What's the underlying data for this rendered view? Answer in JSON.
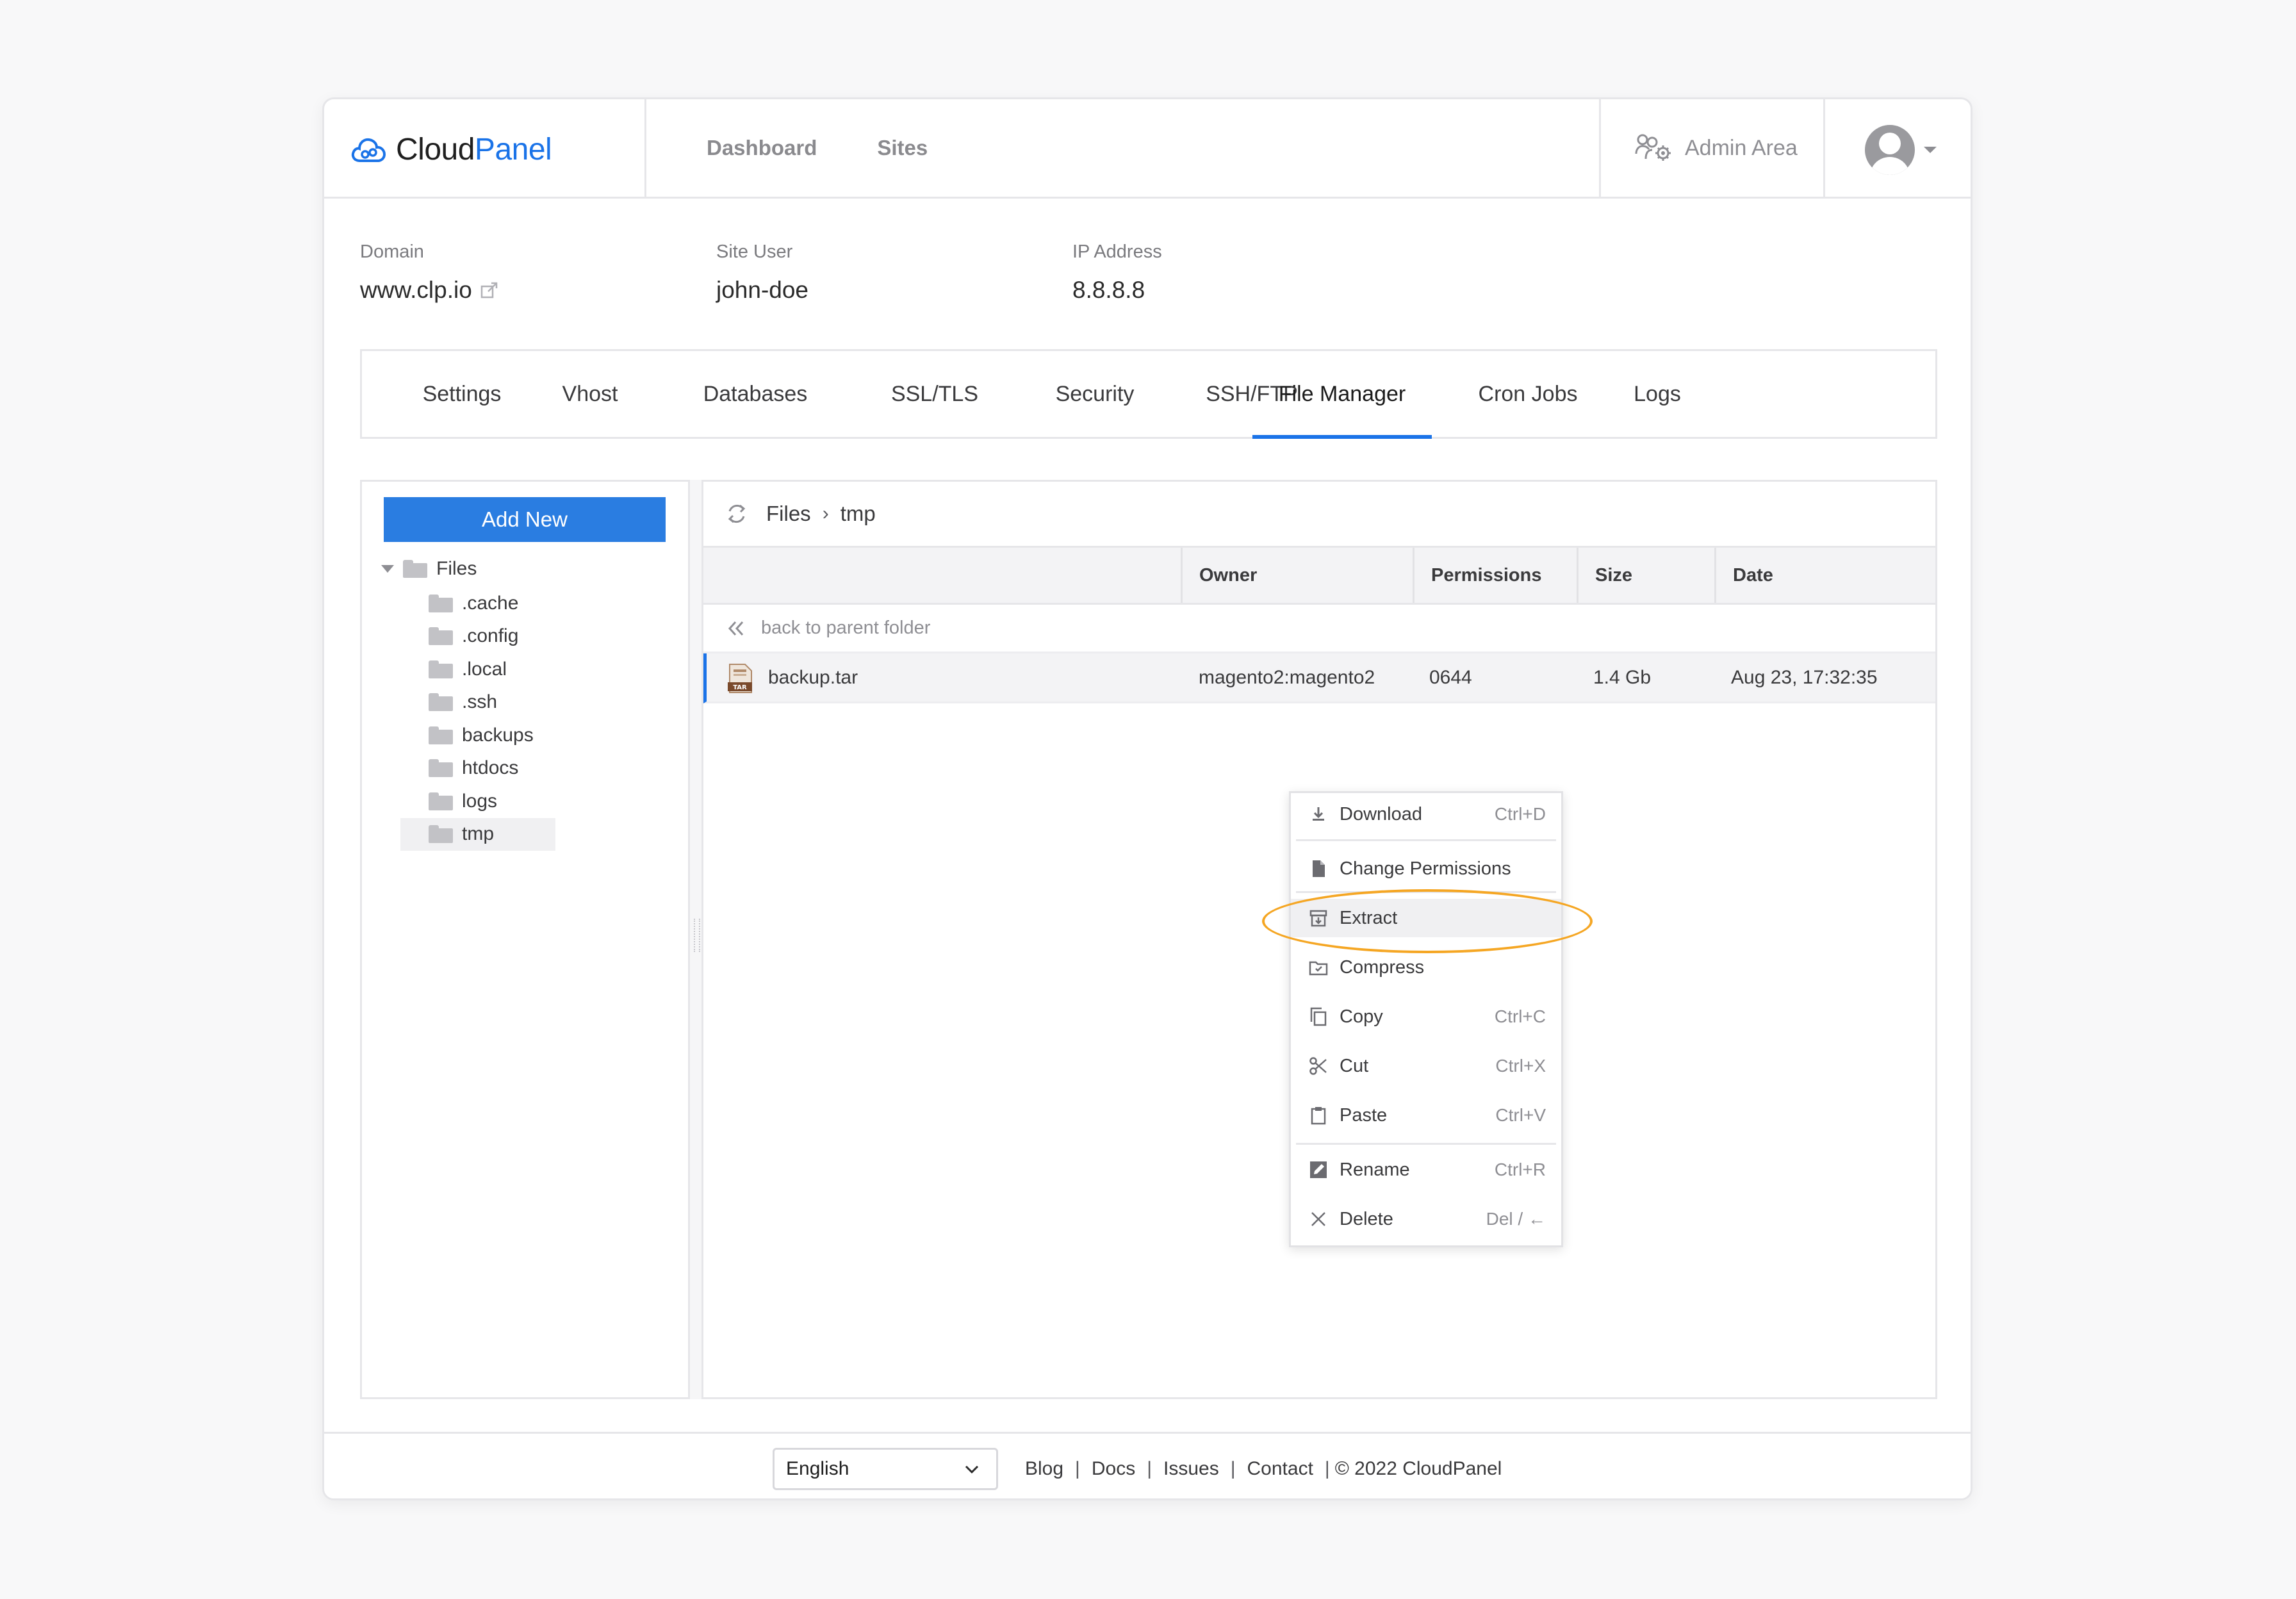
{
  "brand": {
    "name_part1": "Cloud",
    "name_part2": "Panel",
    "accent": "#1a73e8"
  },
  "nav": {
    "items": [
      "Dashboard",
      "Sites"
    ]
  },
  "header": {
    "admin_label": "Admin Area"
  },
  "site": {
    "domain_label": "Domain",
    "domain_value": "www.clp.io",
    "user_label": "Site User",
    "user_value": "john-doe",
    "ip_label": "IP Address",
    "ip_value": "8.8.8.8"
  },
  "tabs": [
    "Settings",
    "Vhost",
    "Databases",
    "SSL/TLS",
    "Security",
    "SSH/FTP",
    "File Manager",
    "Cron Jobs",
    "Logs"
  ],
  "active_tab": "File Manager",
  "tree": {
    "add_button": "Add New",
    "root": "Files",
    "items": [
      ".cache",
      ".config",
      ".local",
      ".ssh",
      "backups",
      "htdocs",
      "logs",
      "tmp"
    ],
    "selected": "tmp"
  },
  "files": {
    "breadcrumb": [
      "Files",
      "tmp"
    ],
    "columns": {
      "owner": "Owner",
      "permissions": "Permissions",
      "size": "Size",
      "date": "Date"
    },
    "back_label": "back to parent folder",
    "rows": [
      {
        "name": "backup.tar",
        "owner": "magento2:magento2",
        "permissions": "0644",
        "size": "1.4 Gb",
        "date": "Aug 23, 17:32:35"
      }
    ]
  },
  "context_menu": {
    "download": {
      "label": "Download",
      "shortcut": "Ctrl+D"
    },
    "change_permissions": {
      "label": "Change Permissions"
    },
    "extract": {
      "label": "Extract"
    },
    "compress": {
      "label": "Compress"
    },
    "copy": {
      "label": "Copy",
      "shortcut": "Ctrl+C"
    },
    "cut": {
      "label": "Cut",
      "shortcut": "Ctrl+X"
    },
    "paste": {
      "label": "Paste",
      "shortcut": "Ctrl+V"
    },
    "rename": {
      "label": "Rename",
      "shortcut": "Ctrl+R"
    },
    "delete": {
      "label": "Delete",
      "shortcut": "Del / ←"
    }
  },
  "highlight_color": "#f5a623",
  "footer": {
    "language": "English",
    "links": [
      "Blog",
      "Docs",
      "Issues",
      "Contact"
    ],
    "copyright": "© 2022  CloudPanel"
  }
}
